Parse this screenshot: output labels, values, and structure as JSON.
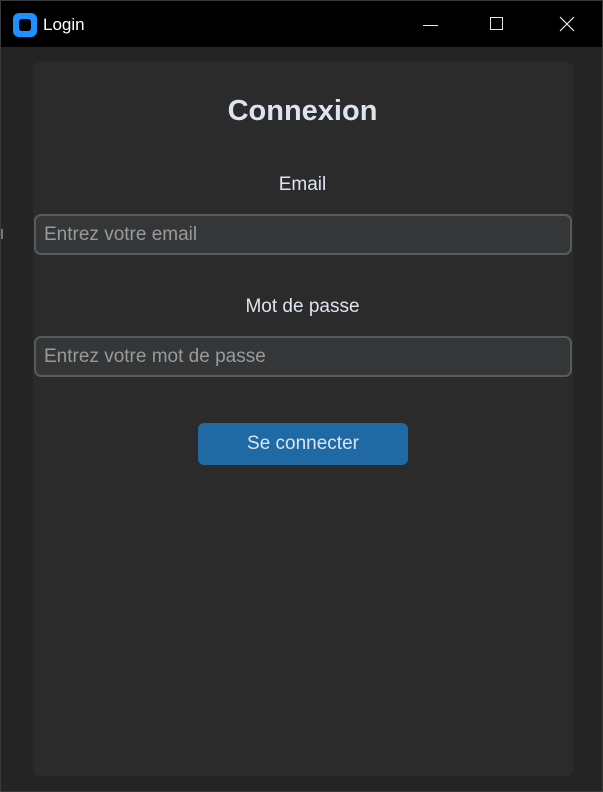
{
  "window": {
    "title": "Login",
    "icon": "app-icon",
    "controls": {
      "minimize_icon": "minimize-icon",
      "maximize_icon": "maximize-icon",
      "close_icon": "close-icon"
    }
  },
  "form": {
    "heading": "Connexion",
    "email": {
      "label": "Email",
      "value": "",
      "placeholder": "Entrez votre email"
    },
    "password": {
      "label": "Mot de passe",
      "value": "",
      "placeholder": "Entrez votre mot de passe"
    },
    "submit_label": "Se connecter"
  },
  "colors": {
    "background": "#242424",
    "panel": "#2b2b2b",
    "accent": "#1f6aa5",
    "text": "#dce4ee",
    "field_border": "#565b5e",
    "field_bg": "#343638"
  }
}
